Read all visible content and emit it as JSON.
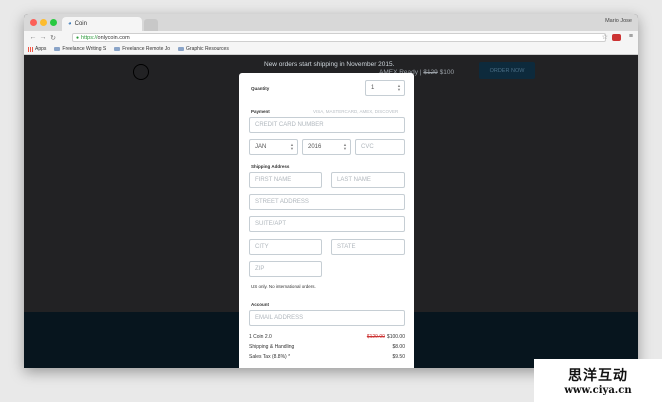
{
  "browser": {
    "tab_title": "Coin",
    "user_name": "Mario Jose",
    "url_scheme": "https://",
    "url_host": "onlycoin.com",
    "bookmarks": [
      "Apps",
      "Freelance Writing S",
      "Freelance Remote Jo",
      "Graphic Resources"
    ]
  },
  "page": {
    "banner": "New orders start shipping in November 2015.",
    "behind_text_prefix": "AMEX Ready |",
    "behind_old_price": "$129",
    "behind_new_price": "$100",
    "order_button": "ORDER NOW"
  },
  "form": {
    "quantity_label": "Quantity",
    "quantity_value": "1",
    "payment_label": "Payment",
    "cards_hint": "VISA, MASTERCARD, AMEX, DISCOVER",
    "card_placeholder": "CREDIT CARD NUMBER",
    "month_value": "JAN",
    "year_value": "2016",
    "cvc_placeholder": "CVC",
    "shipping_label": "Shipping Address",
    "first_name": "FIRST NAME",
    "last_name": "LAST NAME",
    "street": "STREET ADDRESS",
    "suite": "SUITE/APT",
    "city": "CITY",
    "state": "STATE",
    "zip": "ZIP",
    "shipping_note": "US only. No international orders.",
    "account_label": "Account",
    "email_placeholder": "EMAIL ADDRESS"
  },
  "summary": {
    "item_name": "1 Coin 2.0",
    "item_old_price": "$129.00",
    "item_price": "$100.00",
    "shipping_name": "Shipping & Handling",
    "shipping_price": "$8.00",
    "tax_name": "Sales Tax (8.8%) *",
    "tax_price": "$9.50"
  },
  "watermark": {
    "cn": "思洋互动",
    "url": "www.ciya.cn"
  }
}
